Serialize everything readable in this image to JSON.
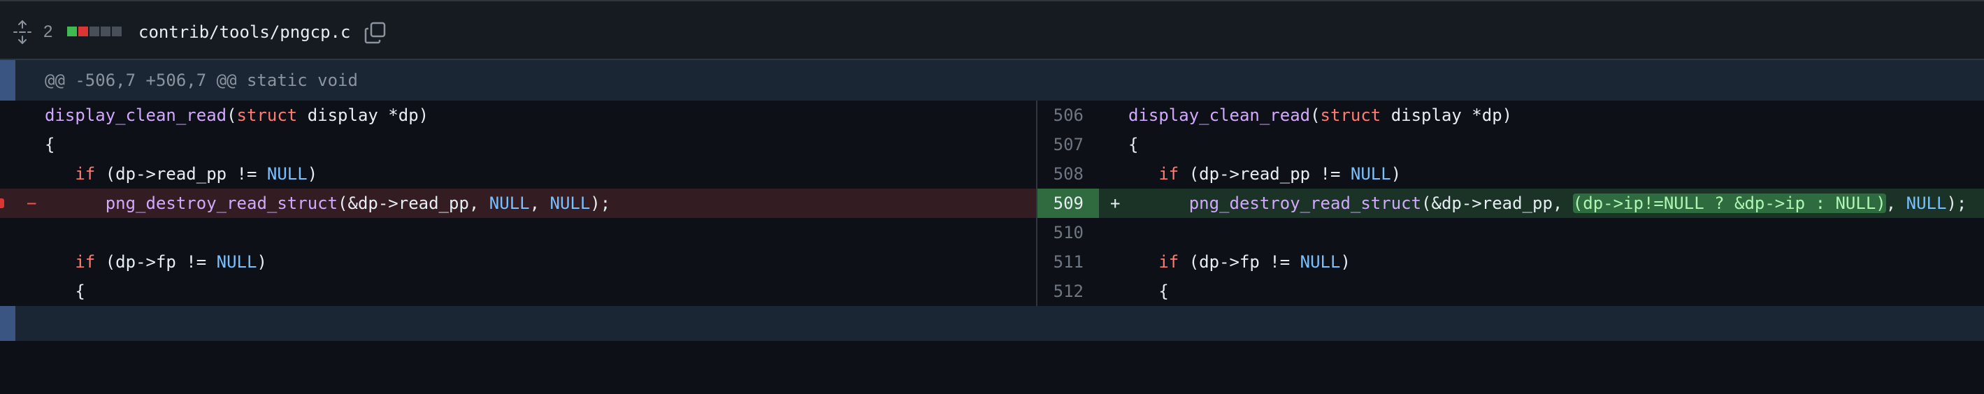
{
  "file": {
    "change_count": "2",
    "path": "contrib/tools/pngcp.c",
    "diffstat": [
      "#3fb950",
      "#da3633",
      "#484f58",
      "#484f58",
      "#484f58"
    ]
  },
  "hunk": {
    "header": "@@ -506,7 +506,7 @@ static void"
  },
  "left": {
    "rows": [
      {
        "fn": "display_clean_read",
        "p1": "(",
        "kw": "struct",
        "p2": " display *dp)"
      },
      {
        "text": "{"
      },
      {
        "indent": "   ",
        "kw": "if",
        "p1": " (dp->read_pp != ",
        "const": "NULL",
        "p2": ")"
      },
      {
        "marker": "−",
        "indent": "      ",
        "fn": "png_destroy_read_struct",
        "p1": "(&dp->read_pp, ",
        "c1": "NULL",
        "p2": ", ",
        "c2": "NULL",
        "p3": ");"
      },
      {
        "text": ""
      },
      {
        "indent": "   ",
        "kw": "if",
        "p1": " (dp->fp != ",
        "const": "NULL",
        "p2": ")"
      },
      {
        "text": "   {"
      }
    ]
  },
  "right": {
    "line_numbers": [
      "506",
      "507",
      "508",
      "509",
      "510",
      "511",
      "512"
    ],
    "rows": [
      {
        "fn": "display_clean_read",
        "p1": "(",
        "kw": "struct",
        "p2": " display *dp)"
      },
      {
        "text": "{"
      },
      {
        "indent": "   ",
        "kw": "if",
        "p1": " (dp->read_pp != ",
        "const": "NULL",
        "p2": ")"
      },
      {
        "marker": "+",
        "indent": "      ",
        "fn": "png_destroy_read_struct",
        "p1": "(&dp->read_pp, ",
        "h1": "(dp->ip!=",
        "h1c": "NULL",
        "h2": " ? &dp->ip : ",
        "h2c": "NULL",
        "h3": ")",
        "p2": ", ",
        "c2": "NULL",
        "p3": ");"
      },
      {
        "text": ""
      },
      {
        "indent": "   ",
        "kw": "if",
        "p1": " (dp->fp != ",
        "const": "NULL",
        "p2": ")"
      },
      {
        "text": "   {"
      }
    ]
  }
}
